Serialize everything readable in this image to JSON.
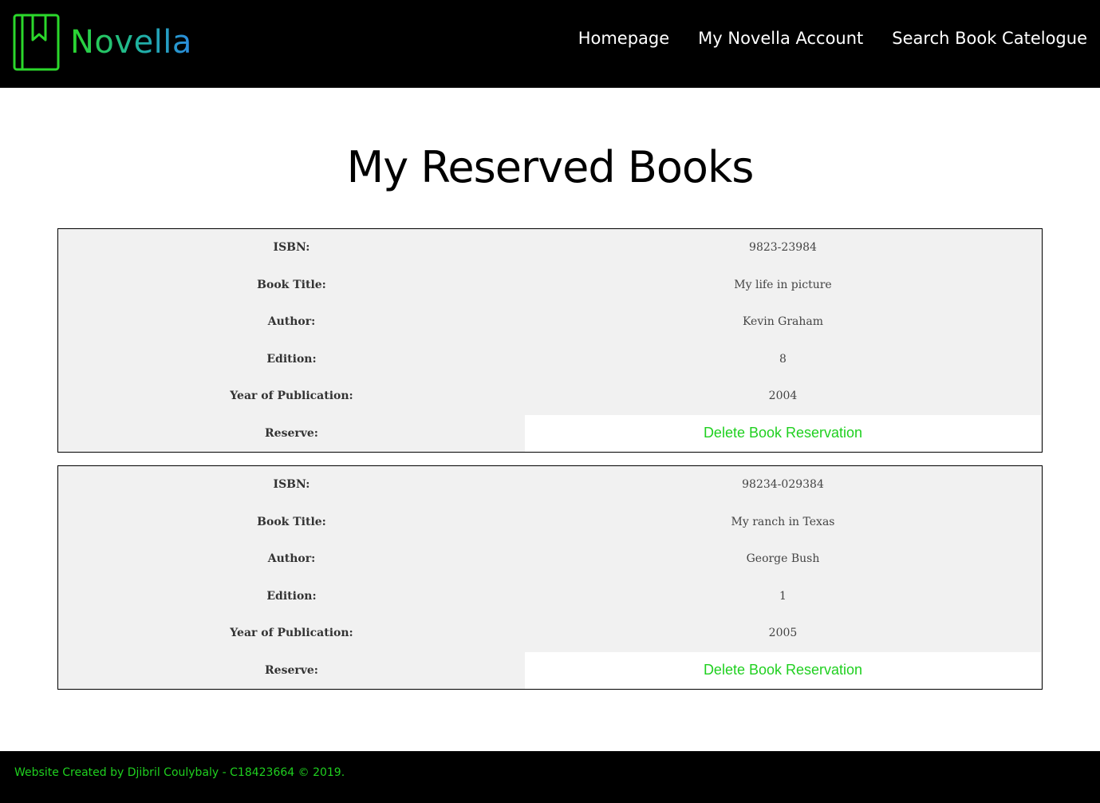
{
  "header": {
    "logo_text": "Novella",
    "nav": [
      {
        "label": "Homepage"
      },
      {
        "label": "My Novella Account"
      },
      {
        "label": "Search Book Catelogue"
      }
    ]
  },
  "main": {
    "title": "My Reserved Books",
    "labels": {
      "isbn": "ISBN:",
      "title": "Book Title:",
      "author": "Author:",
      "edition": "Edition:",
      "year": "Year of Publication:",
      "reserve": "Reserve:"
    },
    "books": [
      {
        "isbn": "9823-23984",
        "title": "My life in picture",
        "author": "Kevin Graham",
        "edition": "8",
        "year": "2004",
        "action_label": "Delete Book Reservation"
      },
      {
        "isbn": "98234-029384",
        "title": "My ranch in Texas",
        "author": "George Bush",
        "edition": "1",
        "year": "2005",
        "action_label": "Delete Book Reservation"
      }
    ]
  },
  "footer": {
    "text": "Website Created by Djibril Coulybaly - C18423664 © 2019."
  },
  "colors": {
    "header_bg": "#000000",
    "accent_green": "#1fd01f",
    "card_bg": "#f1f1f1"
  }
}
